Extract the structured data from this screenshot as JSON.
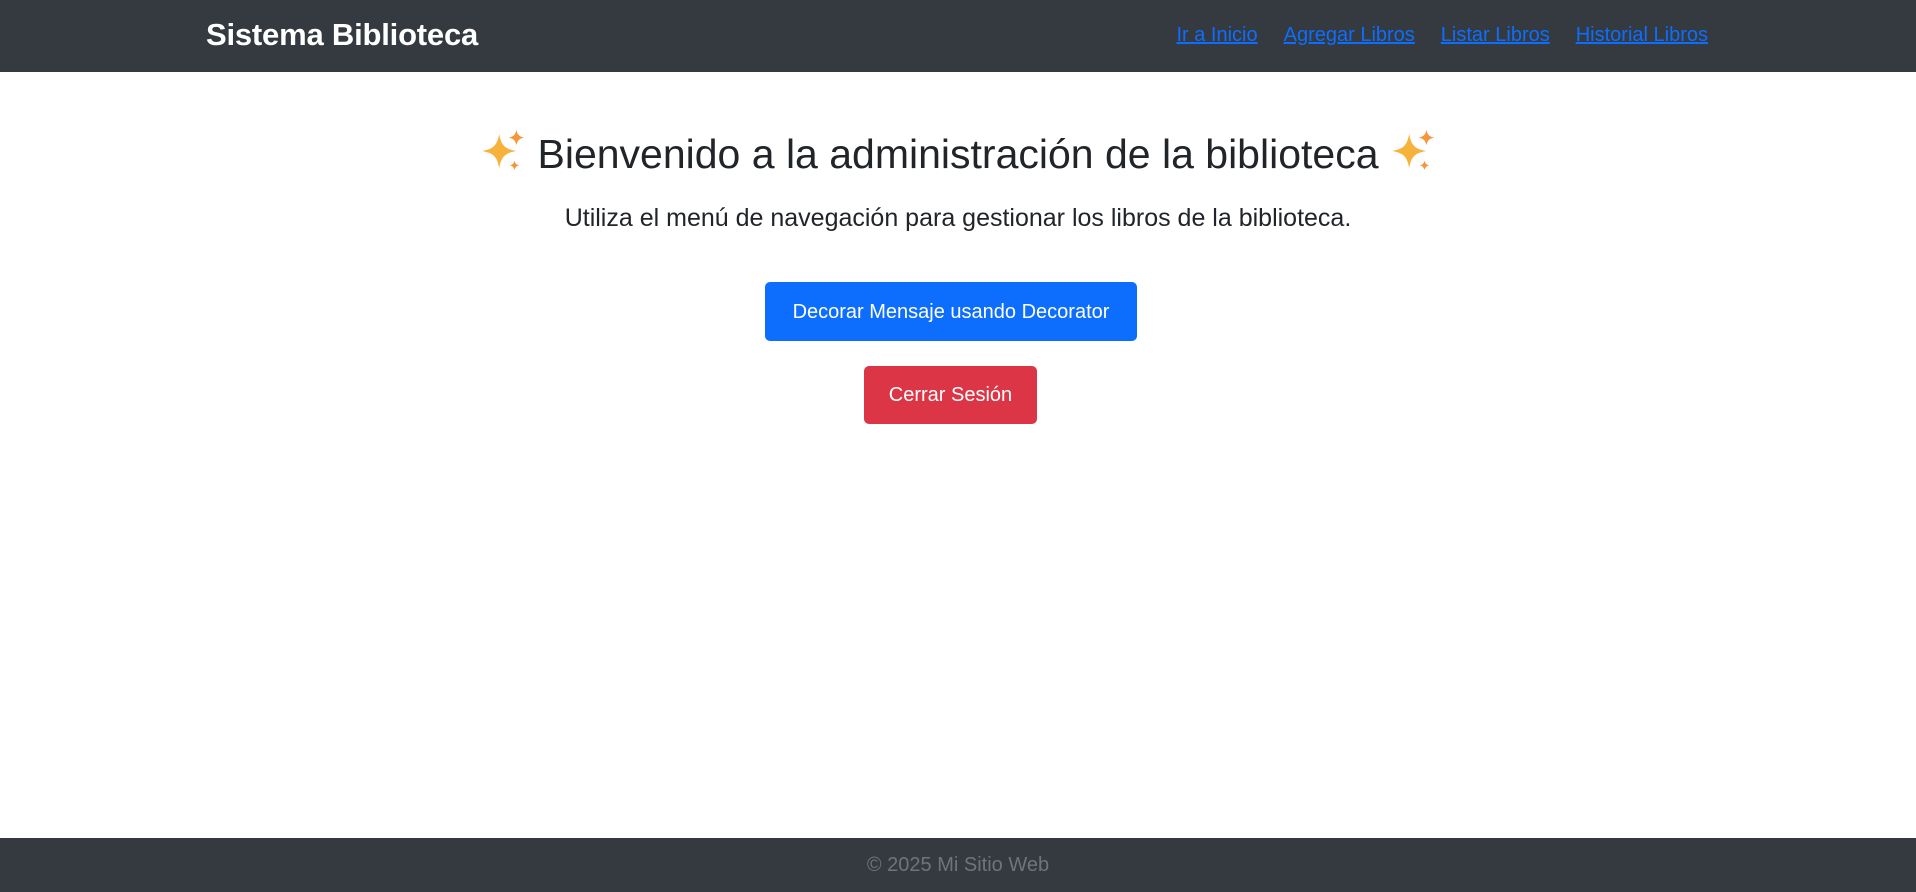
{
  "navbar": {
    "brand": "Sistema Biblioteca",
    "links": [
      {
        "label": "Ir a Inicio"
      },
      {
        "label": "Agregar Libros"
      },
      {
        "label": "Listar Libros"
      },
      {
        "label": "Historial Libros"
      }
    ],
    "background": "#343a40",
    "link_color": "#0d6efd"
  },
  "main": {
    "heading": "Bienvenido a la administración de la biblioteca",
    "heading_decoration_icon": "sparkles-icon",
    "subtitle": "Utiliza el menú de navegación para gestionar los libros de la biblioteca.",
    "decorate_button": {
      "label": "Decorar Mensaje usando Decorator",
      "color": "#0d6efd"
    },
    "logout_button": {
      "label": "Cerrar Sesión",
      "color": "#dc3545"
    }
  },
  "footer": {
    "text": "© 2025 Mi Sitio Web",
    "background": "#343a40"
  }
}
